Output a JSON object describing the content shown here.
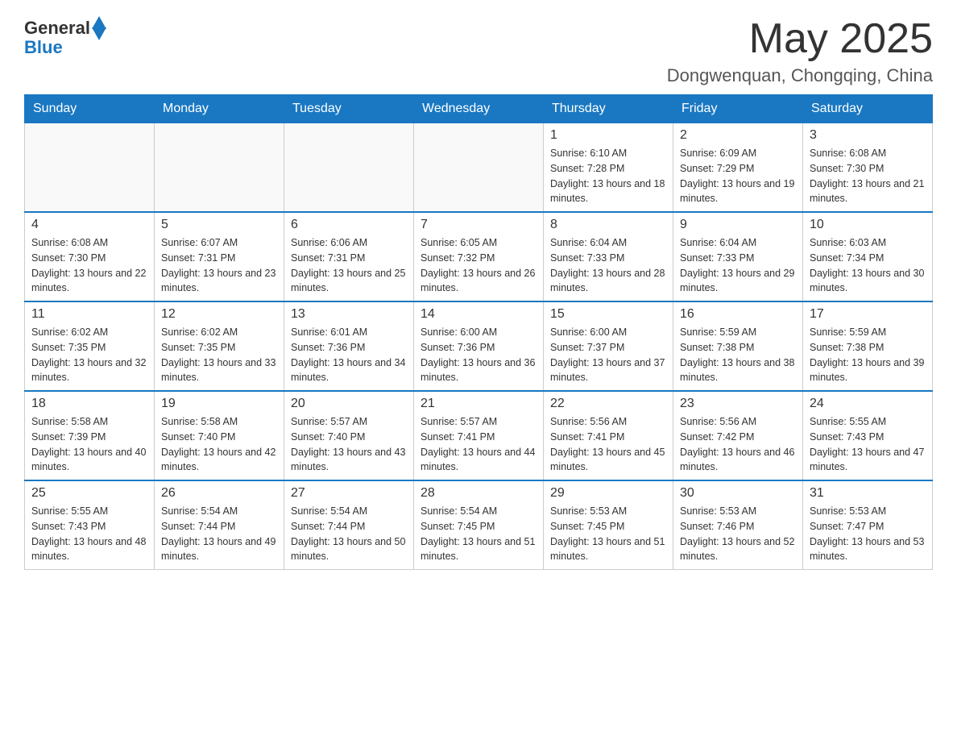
{
  "header": {
    "logo_general": "General",
    "logo_blue": "Blue",
    "month_year": "May 2025",
    "location": "Dongwenquan, Chongqing, China"
  },
  "weekdays": [
    "Sunday",
    "Monday",
    "Tuesday",
    "Wednesday",
    "Thursday",
    "Friday",
    "Saturday"
  ],
  "weeks": [
    [
      {
        "day": "",
        "info": ""
      },
      {
        "day": "",
        "info": ""
      },
      {
        "day": "",
        "info": ""
      },
      {
        "day": "",
        "info": ""
      },
      {
        "day": "1",
        "info": "Sunrise: 6:10 AM\nSunset: 7:28 PM\nDaylight: 13 hours and 18 minutes."
      },
      {
        "day": "2",
        "info": "Sunrise: 6:09 AM\nSunset: 7:29 PM\nDaylight: 13 hours and 19 minutes."
      },
      {
        "day": "3",
        "info": "Sunrise: 6:08 AM\nSunset: 7:30 PM\nDaylight: 13 hours and 21 minutes."
      }
    ],
    [
      {
        "day": "4",
        "info": "Sunrise: 6:08 AM\nSunset: 7:30 PM\nDaylight: 13 hours and 22 minutes."
      },
      {
        "day": "5",
        "info": "Sunrise: 6:07 AM\nSunset: 7:31 PM\nDaylight: 13 hours and 23 minutes."
      },
      {
        "day": "6",
        "info": "Sunrise: 6:06 AM\nSunset: 7:31 PM\nDaylight: 13 hours and 25 minutes."
      },
      {
        "day": "7",
        "info": "Sunrise: 6:05 AM\nSunset: 7:32 PM\nDaylight: 13 hours and 26 minutes."
      },
      {
        "day": "8",
        "info": "Sunrise: 6:04 AM\nSunset: 7:33 PM\nDaylight: 13 hours and 28 minutes."
      },
      {
        "day": "9",
        "info": "Sunrise: 6:04 AM\nSunset: 7:33 PM\nDaylight: 13 hours and 29 minutes."
      },
      {
        "day": "10",
        "info": "Sunrise: 6:03 AM\nSunset: 7:34 PM\nDaylight: 13 hours and 30 minutes."
      }
    ],
    [
      {
        "day": "11",
        "info": "Sunrise: 6:02 AM\nSunset: 7:35 PM\nDaylight: 13 hours and 32 minutes."
      },
      {
        "day": "12",
        "info": "Sunrise: 6:02 AM\nSunset: 7:35 PM\nDaylight: 13 hours and 33 minutes."
      },
      {
        "day": "13",
        "info": "Sunrise: 6:01 AM\nSunset: 7:36 PM\nDaylight: 13 hours and 34 minutes."
      },
      {
        "day": "14",
        "info": "Sunrise: 6:00 AM\nSunset: 7:36 PM\nDaylight: 13 hours and 36 minutes."
      },
      {
        "day": "15",
        "info": "Sunrise: 6:00 AM\nSunset: 7:37 PM\nDaylight: 13 hours and 37 minutes."
      },
      {
        "day": "16",
        "info": "Sunrise: 5:59 AM\nSunset: 7:38 PM\nDaylight: 13 hours and 38 minutes."
      },
      {
        "day": "17",
        "info": "Sunrise: 5:59 AM\nSunset: 7:38 PM\nDaylight: 13 hours and 39 minutes."
      }
    ],
    [
      {
        "day": "18",
        "info": "Sunrise: 5:58 AM\nSunset: 7:39 PM\nDaylight: 13 hours and 40 minutes."
      },
      {
        "day": "19",
        "info": "Sunrise: 5:58 AM\nSunset: 7:40 PM\nDaylight: 13 hours and 42 minutes."
      },
      {
        "day": "20",
        "info": "Sunrise: 5:57 AM\nSunset: 7:40 PM\nDaylight: 13 hours and 43 minutes."
      },
      {
        "day": "21",
        "info": "Sunrise: 5:57 AM\nSunset: 7:41 PM\nDaylight: 13 hours and 44 minutes."
      },
      {
        "day": "22",
        "info": "Sunrise: 5:56 AM\nSunset: 7:41 PM\nDaylight: 13 hours and 45 minutes."
      },
      {
        "day": "23",
        "info": "Sunrise: 5:56 AM\nSunset: 7:42 PM\nDaylight: 13 hours and 46 minutes."
      },
      {
        "day": "24",
        "info": "Sunrise: 5:55 AM\nSunset: 7:43 PM\nDaylight: 13 hours and 47 minutes."
      }
    ],
    [
      {
        "day": "25",
        "info": "Sunrise: 5:55 AM\nSunset: 7:43 PM\nDaylight: 13 hours and 48 minutes."
      },
      {
        "day": "26",
        "info": "Sunrise: 5:54 AM\nSunset: 7:44 PM\nDaylight: 13 hours and 49 minutes."
      },
      {
        "day": "27",
        "info": "Sunrise: 5:54 AM\nSunset: 7:44 PM\nDaylight: 13 hours and 50 minutes."
      },
      {
        "day": "28",
        "info": "Sunrise: 5:54 AM\nSunset: 7:45 PM\nDaylight: 13 hours and 51 minutes."
      },
      {
        "day": "29",
        "info": "Sunrise: 5:53 AM\nSunset: 7:45 PM\nDaylight: 13 hours and 51 minutes."
      },
      {
        "day": "30",
        "info": "Sunrise: 5:53 AM\nSunset: 7:46 PM\nDaylight: 13 hours and 52 minutes."
      },
      {
        "day": "31",
        "info": "Sunrise: 5:53 AM\nSunset: 7:47 PM\nDaylight: 13 hours and 53 minutes."
      }
    ]
  ]
}
